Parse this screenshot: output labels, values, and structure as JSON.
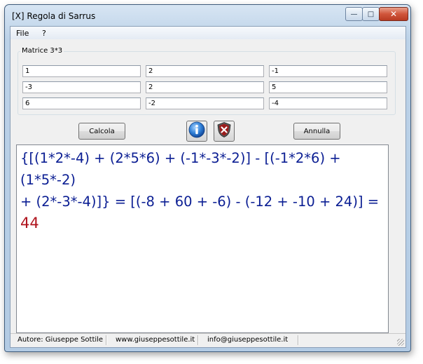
{
  "window": {
    "title": "[X] Regola di Sarrus",
    "minimize_glyph": "—",
    "maximize_glyph": "□",
    "close_glyph": "✕"
  },
  "menu": {
    "items": [
      "File",
      "?"
    ]
  },
  "matrix": {
    "label": "Matrice 3*3",
    "rows": [
      [
        "1",
        "2",
        "-1"
      ],
      [
        "-3",
        "2",
        "5"
      ],
      [
        "6",
        "-2",
        "-4"
      ]
    ]
  },
  "buttons": {
    "calcola": "Calcola",
    "annulla": "Annulla"
  },
  "result": {
    "line1": "{[(1*2*-4) + (2*5*6) + (-1*-3*-2)] - [(-1*2*6) + (1*5*-2)",
    "line2": "+ (2*-3*-4)]} = [(-8 + 60 + -6) - (-12 + -10 + 24)] = ",
    "value": "44"
  },
  "status": {
    "author": "Autore: Giuseppe Sottile",
    "website": "www.giuseppesottile.it",
    "email": "info@giuseppesottile.it"
  },
  "colors": {
    "result_text": "#0b1e93",
    "result_value": "#b0141e",
    "info_icon": "#2f7fd6",
    "cancel_icon": "#9b1c1c"
  },
  "icons": {
    "info": "info-icon",
    "cancel": "shield-x-icon"
  }
}
